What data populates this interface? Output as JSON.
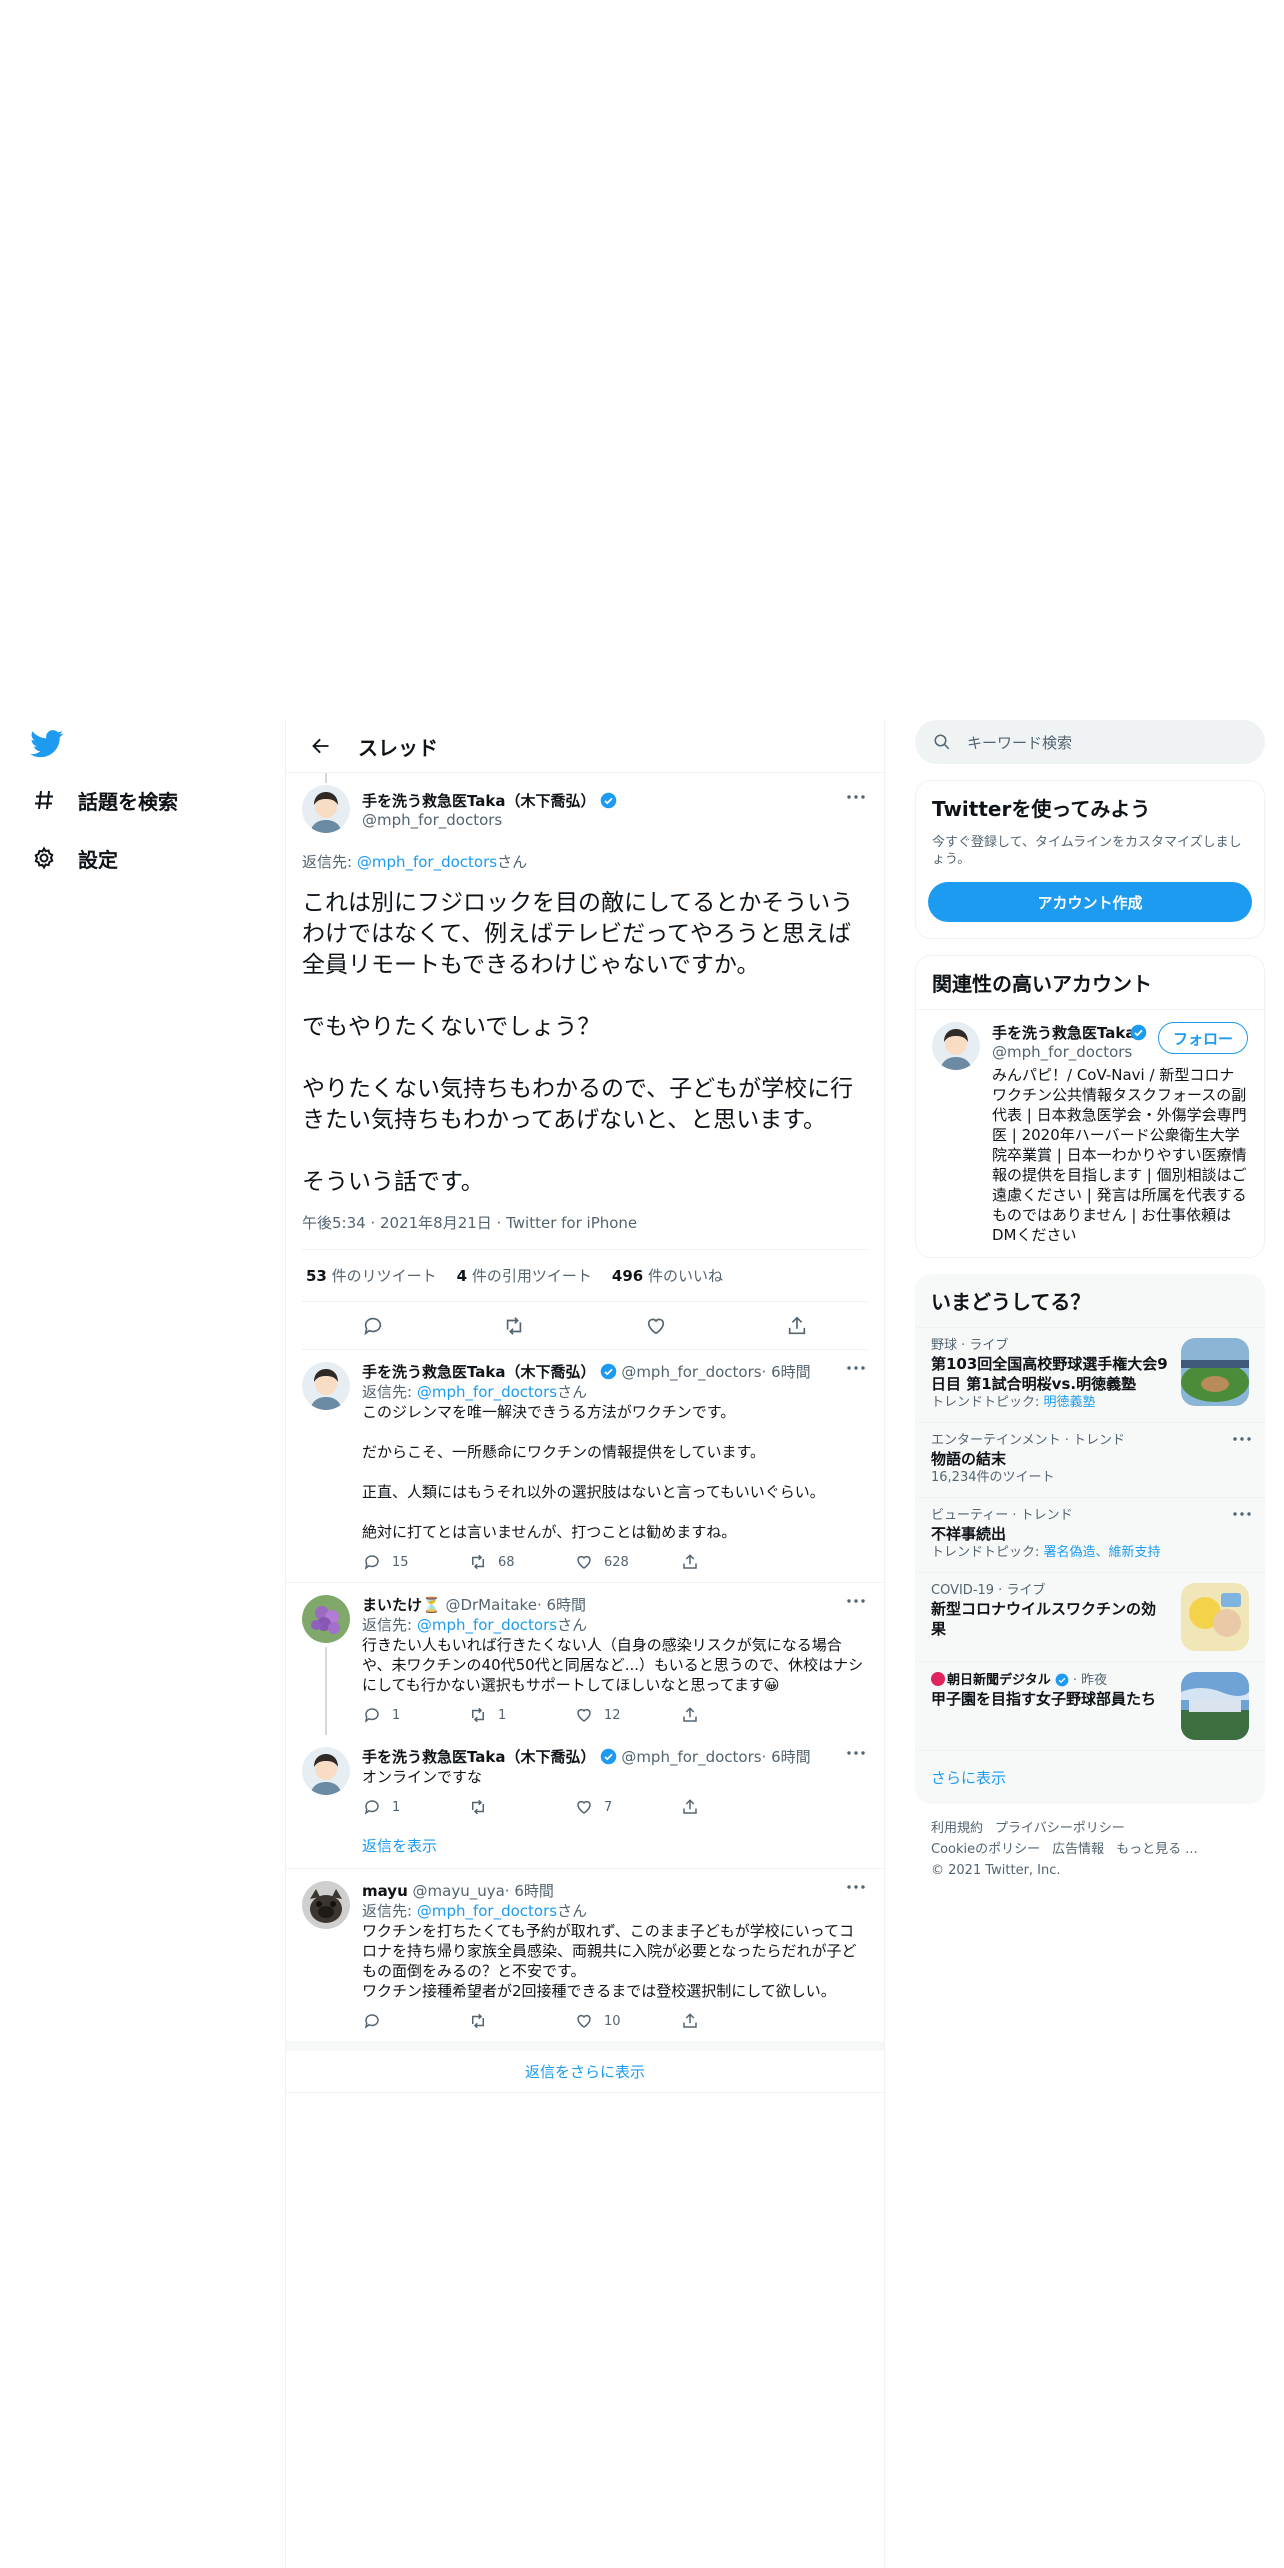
{
  "nav": {
    "explore_label": "話題を検索",
    "settings_label": "設定"
  },
  "header": {
    "title": "スレッド"
  },
  "focus_tweet": {
    "name": "手を洗う救急医Taka（木下喬弘）",
    "handle": "@mph_for_doctors",
    "reply_prefix": "返信先: ",
    "reply_handle": "@mph_for_doctors",
    "reply_suffix": "さん",
    "body": "これは別にフジロックを目の敵にしてるとかそういうわけではなくて、例えばテレビだってやろうと思えば全員リモートもできるわけじゃないですか。\n\nでもやりたくないでしょう？\n\nやりたくない気持ちもわかるので、子どもが学校に行きたい気持ちもわかってあげないと、と思います。\n\nそういう話です。",
    "meta": "午後5:34 · 2021年8月21日 · Twitter for iPhone",
    "retweets": "53",
    "retweets_label": "件のリツイート",
    "quotes": "4",
    "quotes_label": "件の引用ツイート",
    "likes": "496",
    "likes_label": "件のいいね"
  },
  "replies": [
    {
      "name": "手を洗う救急医Taka（木下喬弘）",
      "handle": "@mph_for_doctors",
      "time": "· 6時間",
      "reply_prefix": "返信先: ",
      "reply_handle": "@mph_for_doctors",
      "reply_suffix": "さん",
      "text": "このジレンマを唯一解決できうる方法がワクチンです。\n\nだからこそ、一所懸命にワクチンの情報提供をしています。\n\n正直、人類にはもうそれ以外の選択肢はないと言ってもいいぐらい。\n\n絶対に打てとは言いませんが、打つことは勧めますね。",
      "replies": "15",
      "retweets": "68",
      "likes": "628"
    },
    {
      "name": "まいたけ⏳",
      "handle": "@DrMaitake",
      "time": "· 6時間",
      "reply_prefix": "返信先: ",
      "reply_handle": "@mph_for_doctors",
      "reply_suffix": "さん",
      "text": "行きたい人もいれば行きたくない人（自身の感染リスクが気になる場合や、未ワクチンの40代50代と同居など...）もいると思うので、休校はナシにしても行かない選択もサポートしてほしいなと思ってます😀",
      "replies": "1",
      "retweets": "1",
      "likes": "12"
    },
    {
      "name": "手を洗う救急医Taka（木下喬弘）",
      "handle": "@mph_for_doctors",
      "time": "· 6時間",
      "text": "オンラインですな",
      "replies": "1",
      "retweets": "",
      "likes": "7"
    },
    {
      "name": "mayu",
      "handle": "@mayu_uya",
      "time": "· 6時間",
      "reply_prefix": "返信先: ",
      "reply_handle": "@mph_for_doctors",
      "reply_suffix": "さん",
      "text": "ワクチンを打ちたくても予約が取れず、このまま子どもが学校にいってコロナを持ち帰り家族全員感染、両親共に入院が必要となったらだれが子どもの面倒をみるの？と不安です。\nワクチン接種希望者が2回接種できるまでは登校選択制にして欲しい。",
      "replies": "",
      "retweets": "",
      "likes": "10"
    }
  ],
  "show_replies_label": "返信を表示",
  "show_more_replies_label": "返信をさらに表示",
  "right": {
    "search_placeholder": "キーワード検索",
    "signup": {
      "title": "Twitterを使ってみよう",
      "subtitle": "今すぐ登録して、タイムラインをカスタマイズしましょう。",
      "button": "アカウント作成"
    },
    "related": {
      "title": "関連性の高いアカウント",
      "name": "手を洗う救急医Taka（木下喬弘）",
      "handle": "@mph_for_doctors",
      "follow": "フォロー",
      "bio": "みんパピ！/ CoV-Navi / 新型コロナワクチン公共情報タスクフォースの副代表 | 日本救急医学会・外傷学会専門医 | 2020年ハーバード公衆衛生大学院卒業賞 | 日本一わかりやすい医療情報の提供を目指します | 個別相談はご遠慮ください | 発言は所属を代表するものではありません | お仕事依頼はDMください"
    },
    "trends": {
      "title": "いまどうしてる？",
      "items": [
        {
          "context": "野球 · ライブ",
          "title": "第103回全国高校野球選手権大会9日目 第1試合明桜vs.明徳義塾",
          "sub_prefix": "トレンドトピック: ",
          "sub_link": "明徳義塾"
        },
        {
          "context": "エンターテインメント · トレンド",
          "title": "物語の結末",
          "sub": "16,234件のツイート"
        },
        {
          "context": "ビューティー · トレンド",
          "title": "不祥事続出",
          "sub_prefix": "トレンドトピック: ",
          "sub_link": "署名偽造、維新支持"
        },
        {
          "context": "COVID-19 · ライブ",
          "title": "新型コロナウイルスワクチンの効果"
        },
        {
          "source": "朝日新聞デジタル",
          "time": "· 昨夜",
          "title": "甲子園を目指す女子野球部員たち"
        }
      ],
      "show_more": "さらに表示"
    },
    "footer": {
      "links": [
        "利用規約",
        "プライバシーポリシー",
        "Cookieのポリシー",
        "広告情報",
        "もっと見る ..."
      ],
      "copyright": "© 2021 Twitter, Inc."
    }
  },
  "colors": {
    "accent": "#1d9bf0",
    "text": "#0f1419",
    "muted": "#536471"
  }
}
